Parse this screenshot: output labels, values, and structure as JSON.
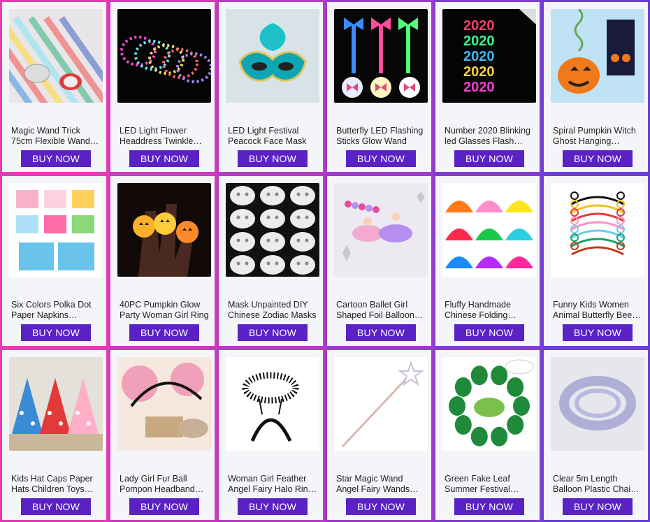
{
  "colors": {
    "accent": "#5a22c4",
    "border_start": "#e63bb4",
    "border_end": "#6a3fd8",
    "card_bg": "#f4f5f8"
  },
  "buy_label": "BUY NOW",
  "products": [
    {
      "title": "Magic Wand Trick 75cm Flexible Wand Magician Ultra-light",
      "icon": "magic-wand"
    },
    {
      "title": "LED Light Flower Headdress Twinkle Wreath Crown",
      "icon": "led-flower-wreaths"
    },
    {
      "title": "LED Light Festival Peacock Face Mask",
      "icon": "peacock-mask"
    },
    {
      "title": "Butterfly LED Flashing Sticks Glow Wand",
      "icon": "butterfly-wands"
    },
    {
      "title": "Number 2020 Blinking led Glasses Flash Party",
      "icon": "led-2020-glasses"
    },
    {
      "title": "Spiral Pumpkin Witch Ghost Hanging Decoration",
      "icon": "pumpkin-spiral"
    },
    {
      "title": "Six Colors Polka Dot Paper Napkins Tableware",
      "icon": "polka-napkins"
    },
    {
      "title": "40PC Pumpkin Glow Party Woman Girl Ring",
      "icon": "pumpkin-glow-ring"
    },
    {
      "title": "Mask Unpainted DIY Chinese Zodiac Masks",
      "icon": "zodiac-masks"
    },
    {
      "title": "Cartoon Ballet Girl Shaped Foil Balloons Birthday",
      "icon": "ballet-balloons"
    },
    {
      "title": "Fluffy Handmade Chinese Folding Feather Fan",
      "icon": "feather-fans"
    },
    {
      "title": "Funny Kids Women Animal Butterfly Bee Headband",
      "icon": "antenna-headbands"
    },
    {
      "title": "Kids Hat Caps Paper Hats Children Toys Birthday",
      "icon": "party-hats"
    },
    {
      "title": "Lady Girl Fur Ball Pompon Headband Ears",
      "icon": "pompom-headband"
    },
    {
      "title": "Woman Girl Feather Angel Fairy Halo Ring Headband",
      "icon": "feather-halo"
    },
    {
      "title": "Star Magic Wand Angel Fairy Wands Party Prop",
      "icon": "star-wand"
    },
    {
      "title": "Green Fake Leaf Summer Festival Decoration",
      "icon": "tropical-leaves"
    },
    {
      "title": "Clear 5m Length Balloon Plastic Chain Tape",
      "icon": "balloon-tape"
    }
  ]
}
